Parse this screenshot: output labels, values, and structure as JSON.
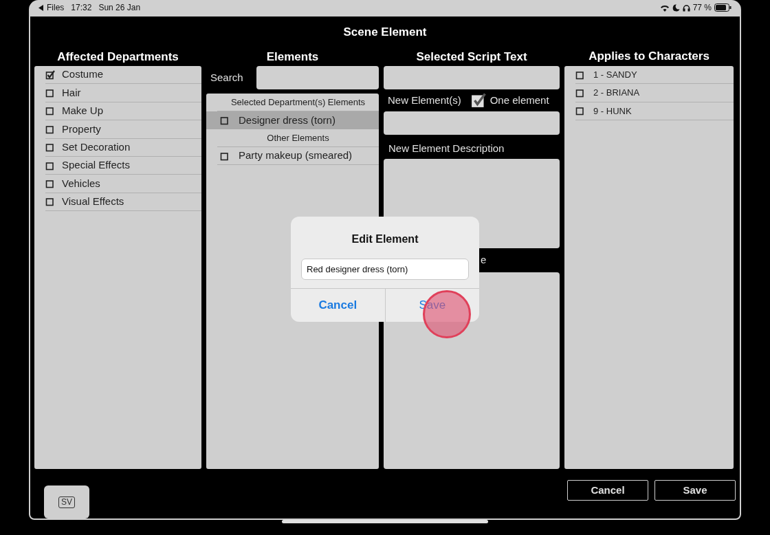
{
  "status_bar": {
    "back_label": "Files",
    "time": "17:32",
    "date": "Sun 26 Jan",
    "battery": "77 %"
  },
  "window": {
    "title": "Scene Element"
  },
  "departments": {
    "title": "Affected Departments",
    "items": [
      {
        "label": "Costume",
        "checked": true
      },
      {
        "label": "Hair",
        "checked": false
      },
      {
        "label": "Make Up",
        "checked": false
      },
      {
        "label": "Property",
        "checked": false
      },
      {
        "label": "Set Decoration",
        "checked": false
      },
      {
        "label": "Special Effects",
        "checked": false
      },
      {
        "label": "Vehicles",
        "checked": false
      },
      {
        "label": "Visual Effects",
        "checked": false
      }
    ]
  },
  "elements": {
    "title": "Elements",
    "search_label": "Search",
    "sections": [
      {
        "header": "Selected Department(s) Elements",
        "items": [
          {
            "label": "Designer dress (torn)",
            "checked": false,
            "selected": true
          }
        ]
      },
      {
        "header": "Other Elements",
        "items": [
          {
            "label": "Party makeup (smeared)",
            "checked": false,
            "selected": false
          }
        ]
      }
    ]
  },
  "script": {
    "title": "Selected Script Text",
    "new_elements_label": "New Element(s)",
    "one_element": {
      "label": "One element",
      "checked": true
    },
    "description_label": "New Element Description",
    "covered_label": "e"
  },
  "characters": {
    "title": "Applies to Characters",
    "items": [
      {
        "label": "1 - SANDY",
        "checked": false
      },
      {
        "label": "2 - BRIANA",
        "checked": false
      },
      {
        "label": "9 - HUNK",
        "checked": false
      }
    ]
  },
  "footer": {
    "badge": "SV",
    "buttons": [
      "Cancel",
      "Save"
    ]
  },
  "dialog": {
    "title": "Edit Element",
    "value": "Red designer dress (torn)",
    "buttons": [
      "Cancel",
      "Save"
    ]
  }
}
